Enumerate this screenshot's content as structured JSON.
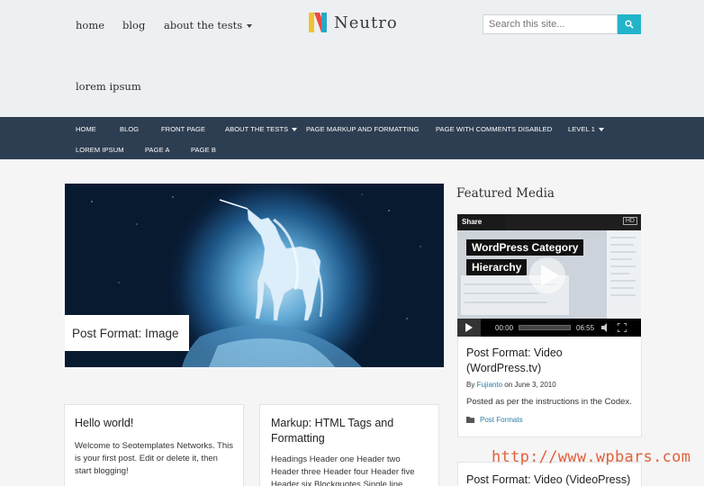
{
  "top_nav": {
    "home": "home",
    "blog": "blog",
    "about": "about the tests"
  },
  "logo": {
    "text": "Neutro",
    "colors": [
      "#f2c12e",
      "#e94a3f",
      "#2aa7c9"
    ]
  },
  "search": {
    "placeholder": "Search this site...",
    "icon": "search-icon",
    "button_color": "#22b5c9"
  },
  "top_link": "lorem ipsum",
  "main_nav": {
    "row1": [
      "HOME",
      "BLOG",
      "FRONT PAGE",
      "ABOUT THE TESTS",
      "PAGE MARKUP AND FORMATTING",
      "PAGE WITH COMMENTS DISABLED",
      "LEVEL 1"
    ],
    "row2": [
      "LOREM IPSUM",
      "PAGE A",
      "PAGE B"
    ],
    "bg_color": "#2e3e52"
  },
  "hero": {
    "caption": "Post Format: Image"
  },
  "posts": [
    {
      "title": "Hello world!",
      "excerpt": "Welcome to Seotemplates Networks. This is your first post. Edit or delete it, then start blogging!"
    },
    {
      "title": "Markup: HTML Tags and Formatting",
      "excerpt": "Headings Header one Header two Header three Header four Header five Header six Blockquotes Single line blockquote: Stay"
    }
  ],
  "sidebar": {
    "title": "Featured Media",
    "video": {
      "share": "Share",
      "hd": "HD",
      "title_line1": "WordPress Category",
      "title_line2": "Hierarchy",
      "time_start": "00:00",
      "time_end": "06:55"
    },
    "post": {
      "title": "Post Format: Video (WordPress.tv)",
      "by": "By",
      "author": "Fujianto",
      "date": "on June 3, 2010",
      "excerpt": "Posted as per the instructions in the Codex.",
      "category": "Post Formats"
    },
    "next_post_title": "Post Format: Video (VideoPress)"
  },
  "watermark": "http://www.wpbars.com"
}
